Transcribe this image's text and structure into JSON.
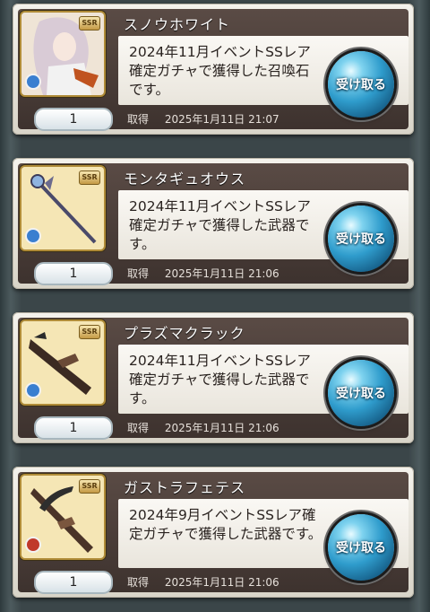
{
  "items": [
    {
      "name": "スノウホワイト",
      "description": "2024年11月イベントSSレア確定ガチャで獲得した召喚石です。",
      "quantity": "1",
      "acquired_label": "取得",
      "acquired_time": "2025年1月11日 21:07",
      "button_label": "受け取る",
      "element_color": "#3a7fd0",
      "icon": "summon-portrait-icon"
    },
    {
      "name": "モンタギュオウス",
      "description": "2024年11月イベントSSレア確定ガチャで獲得した武器です。",
      "quantity": "1",
      "acquired_label": "取得",
      "acquired_time": "2025年1月11日 21:06",
      "button_label": "受け取る",
      "element_color": "#3a7fd0",
      "icon": "staff-weapon-icon"
    },
    {
      "name": "プラズマクラック",
      "description": "2024年11月イベントSSレア確定ガチャで獲得した武器です。",
      "quantity": "1",
      "acquired_label": "取得",
      "acquired_time": "2025年1月11日 21:06",
      "button_label": "受け取る",
      "element_color": "#3a7fd0",
      "icon": "gun-weapon-icon"
    },
    {
      "name": "ガストラフェテス",
      "description": "2024年9月イベントSSレア確定ガチャで獲得した武器です。",
      "quantity": "1",
      "acquired_label": "取得",
      "acquired_time": "2025年1月11日 21:06",
      "button_label": "受け取る",
      "element_color": "#c0392b",
      "icon": "crossbow-weapon-icon"
    }
  ],
  "badge": "SSR"
}
